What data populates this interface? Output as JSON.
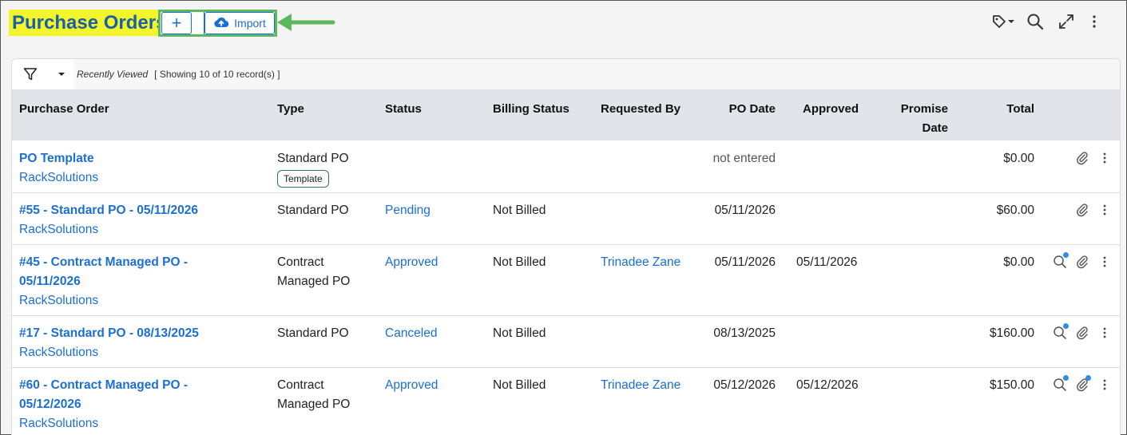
{
  "header": {
    "title": "Purchase Orders",
    "add_label": "+",
    "import_label": "Import"
  },
  "filter": {
    "recent_label": "Recently Viewed",
    "showing_label": "[ Showing 10 of 10 record(s) ]"
  },
  "columns": [
    "Purchase Order",
    "Type",
    "Status",
    "Billing Status",
    "Requested By",
    "PO Date",
    "Approved",
    "Promise Date",
    "Total"
  ],
  "rows": [
    {
      "po_line1": "PO Template",
      "po_line2": "",
      "vendor": "RackSolutions",
      "type_line1": "Standard PO",
      "type_line2": "",
      "badge": "Template",
      "status": "",
      "billing": "",
      "requested_by": "",
      "po_date": "not entered",
      "approved": "",
      "promise": "",
      "total": "$0.00",
      "icons": [
        "attachment-icon",
        "more-icon"
      ]
    },
    {
      "po_line1": "#55 - Standard PO - 05/11/2026",
      "po_line2": "",
      "vendor": "RackSolutions",
      "type_line1": "Standard PO",
      "type_line2": "",
      "badge": "",
      "status": "Pending",
      "billing": "Not Billed",
      "requested_by": "",
      "po_date": "05/11/2026",
      "approved": "",
      "promise": "",
      "total": "$60.00",
      "icons": [
        "attachment-icon",
        "more-icon"
      ]
    },
    {
      "po_line1": "#45 - Contract Managed PO -",
      "po_line2": "05/11/2026",
      "vendor": "RackSolutions",
      "type_line1": "Contract",
      "type_line2": "Managed PO",
      "badge": "",
      "status": "Approved",
      "billing": "Not Billed",
      "requested_by": "Trinadee Zane",
      "po_date": "05/11/2026",
      "approved": "05/11/2026",
      "promise": "",
      "total": "$0.00",
      "icons": [
        "search-icon",
        "attachment-icon",
        "more-icon"
      ]
    },
    {
      "po_line1": "#17 - Standard PO - 08/13/2025",
      "po_line2": "",
      "vendor": "RackSolutions",
      "type_line1": "Standard PO",
      "type_line2": "",
      "badge": "",
      "status": "Canceled",
      "billing": "Not Billed",
      "requested_by": "",
      "po_date": "08/13/2025",
      "approved": "",
      "promise": "",
      "total": "$160.00",
      "icons": [
        "search-icon",
        "attachment-icon",
        "more-icon"
      ]
    },
    {
      "po_line1": "#60 - Contract Managed PO -",
      "po_line2": "05/12/2026",
      "vendor": "RackSolutions",
      "type_line1": "Contract",
      "type_line2": "Managed PO",
      "badge": "",
      "status": "Approved",
      "billing": "Not Billed",
      "requested_by": "Trinadee Zane",
      "po_date": "05/12/2026",
      "approved": "05/12/2026",
      "promise": "",
      "total": "$150.00",
      "icons": [
        "search-icon",
        "attachment-icon",
        "more-icon"
      ]
    }
  ],
  "colors": {
    "accent": "#1a6fd4",
    "highlight": "#f2f52a",
    "annotation": "#5cb85c"
  }
}
